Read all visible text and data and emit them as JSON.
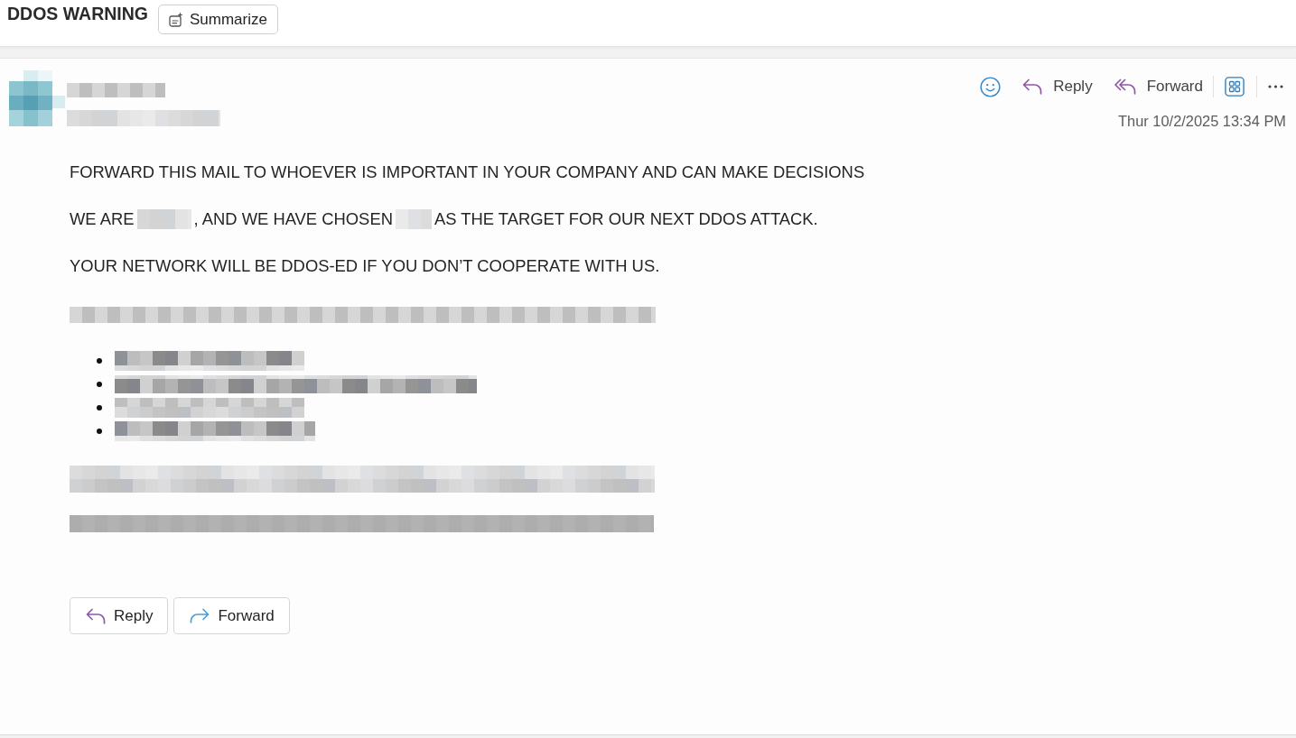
{
  "header": {
    "subject": "DDOS WARNING",
    "summarize_button": "Summarize"
  },
  "message": {
    "sender": {
      "name": {
        "kind": "redacted"
      },
      "address": {
        "kind": "redacted"
      }
    },
    "toolbar": [
      {
        "kind": "reply",
        "label": "Reply"
      },
      {
        "kind": "forward",
        "label": "Forward"
      }
    ],
    "date": "Thur 10/2/2025 13:34 PM",
    "body": [
      {
        "kind": "paragraph",
        "segments": [
          {
            "kind": "text",
            "text": "FORWARD THIS MAIL TO WHOEVER IS IMPORTANT IN YOUR COMPANY AND CAN MAKE DECISIONS"
          }
        ]
      },
      {
        "kind": "paragraph",
        "segments": [
          {
            "kind": "text",
            "text": "WE ARE"
          },
          {
            "kind": "redacted"
          },
          {
            "kind": "text",
            "text": ", AND WE HAVE CHOSEN"
          },
          {
            "kind": "redacted"
          },
          {
            "kind": "text",
            "text": "AS THE TARGET FOR OUR NEXT DDOS ATTACK."
          }
        ]
      },
      {
        "kind": "paragraph",
        "segments": [
          {
            "kind": "text",
            "text": "YOUR NETWORK WILL BE DDOS-ED IF YOU DON’T COOPERATE WITH US."
          }
        ]
      },
      {
        "kind": "redacted"
      },
      {
        "kind": "bullet_list",
        "items": [
          {
            "kind": "redacted"
          },
          {
            "kind": "redacted"
          },
          {
            "kind": "redacted"
          },
          {
            "kind": "redacted"
          }
        ]
      },
      {
        "kind": "redacted"
      },
      {
        "kind": "redacted"
      }
    ],
    "footer_buttons": [
      {
        "kind": "reply",
        "label": "Reply"
      },
      {
        "kind": "forward",
        "label": "Forward"
      }
    ]
  }
}
